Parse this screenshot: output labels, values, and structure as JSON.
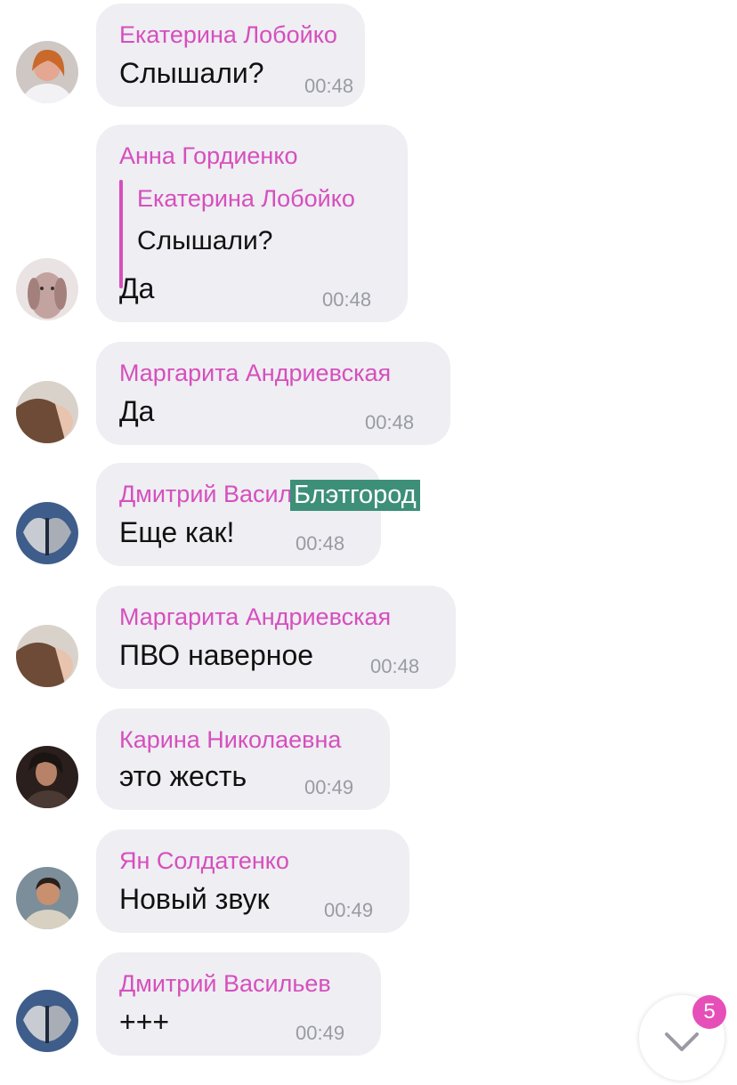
{
  "messages": [
    {
      "sender": "Екатерина Лобойко",
      "text": "Слышали?",
      "time": "00:48"
    },
    {
      "sender": "Анна Гордиенко",
      "reply_to": {
        "sender": "Екатерина Лобойко",
        "text": "Слышали?"
      },
      "text": "Да",
      "time": "00:48"
    },
    {
      "sender": "Маргарита Андриевская",
      "text": "Да",
      "time": "00:48"
    },
    {
      "sender": "Дмитрий Васильев",
      "text": "Еще как!",
      "time": "00:48"
    },
    {
      "sender": "Маргарита Андриевская",
      "text": "ПВО наверное",
      "time": "00:48"
    },
    {
      "sender": "Карина Николаевна",
      "text": "это жесть",
      "time": "00:49"
    },
    {
      "sender": "Ян Солдатенко",
      "text": "Новый звук",
      "time": "00:49"
    },
    {
      "sender": "Дмитрий Васильев",
      "text": "+++",
      "time": "00:49"
    }
  ],
  "watermark": "Блэтгород",
  "scroll_button": {
    "icon": "chevron-down-icon",
    "unread_count": "5"
  },
  "colors": {
    "sender_name": "#d64fbd",
    "bubble_background": "#eeeef3",
    "time_text": "#9a9aa3",
    "badge": "#e64fb8",
    "watermark_background": "#3d8f78"
  }
}
